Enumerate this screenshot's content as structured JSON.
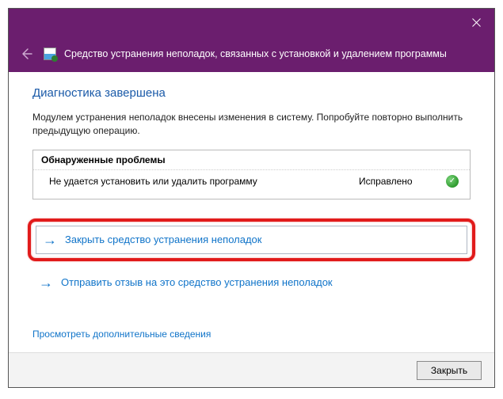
{
  "header": {
    "title": "Средство устранения неполадок, связанных с установкой и удалением программы"
  },
  "main": {
    "section_title": "Диагностика завершена",
    "description": "Модулем устранения неполадок внесены изменения в систему. Попробуйте повторно выполнить предыдущую операцию.",
    "problems_header": "Обнаруженные проблемы",
    "problem": {
      "name": "Не удается установить или удалить программу",
      "status": "Исправлено"
    },
    "actions": {
      "close_troubleshooter": "Закрыть средство устранения неполадок",
      "send_feedback": "Отправить отзыв на это средство устранения неполадок"
    },
    "more_info": "Просмотреть дополнительные сведения"
  },
  "footer": {
    "close_label": "Закрыть"
  }
}
